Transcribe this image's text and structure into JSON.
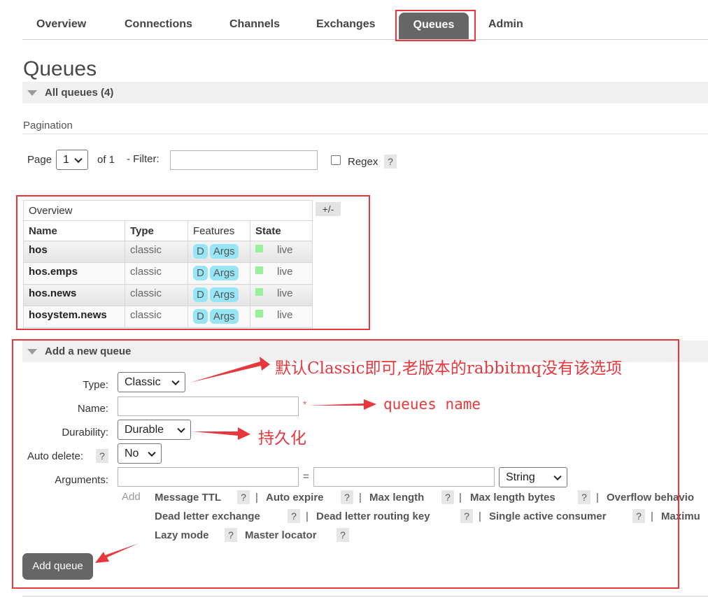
{
  "nav": {
    "tabs": [
      {
        "label": "Overview"
      },
      {
        "label": "Connections"
      },
      {
        "label": "Channels"
      },
      {
        "label": "Exchanges"
      },
      {
        "label": "Queues"
      },
      {
        "label": "Admin"
      }
    ],
    "active_tab": "Queues"
  },
  "page_title": "Queues",
  "all_queues": {
    "label": "All queues (4)"
  },
  "pagination": {
    "section_label": "Pagination",
    "page_label": "Page",
    "page_value": "1",
    "of_label": "of 1",
    "filter_label": "- Filter:",
    "filter_value": "",
    "regex_label": "Regex",
    "help": "?"
  },
  "table": {
    "caption": "Overview",
    "toggle_columns": "+/-",
    "headers": {
      "name": "Name",
      "type": "Type",
      "features": "Features",
      "state": "State"
    },
    "rows": [
      {
        "name": "hos",
        "type": "classic",
        "feat_d": "D",
        "feat_args": "Args",
        "state": "live"
      },
      {
        "name": "hos.emps",
        "type": "classic",
        "feat_d": "D",
        "feat_args": "Args",
        "state": "live"
      },
      {
        "name": "hos.news",
        "type": "classic",
        "feat_d": "D",
        "feat_args": "Args",
        "state": "live"
      },
      {
        "name": "hosystem.news",
        "type": "classic",
        "feat_d": "D",
        "feat_args": "Args",
        "state": "live"
      }
    ]
  },
  "add_queue": {
    "section_label": "Add a new queue",
    "type_label": "Type:",
    "type_value": "Classic",
    "name_label": "Name:",
    "name_value": "",
    "name_required": "*",
    "durability_label": "Durability:",
    "durability_value": "Durable",
    "auto_delete_label": "Auto delete:",
    "auto_delete_help": "?",
    "auto_delete_value": "No",
    "arguments_label": "Arguments:",
    "arg_key": "",
    "arg_equals": "=",
    "arg_value": "",
    "arg_type": "String",
    "add_label": "Add",
    "arg_links": {
      "message_ttl": "Message TTL",
      "auto_expire": "Auto expire",
      "max_length": "Max length",
      "max_length_bytes": "Max length bytes",
      "overflow_behaviour": "Overflow behavio",
      "dead_letter_exchange": "Dead letter exchange",
      "dead_letter_routing_key": "Dead letter routing key",
      "single_active_consumer": "Single active consumer",
      "maximum_priority": "Maximu",
      "lazy_mode": "Lazy mode",
      "master_locator": "Master locator"
    },
    "help": "?",
    "separator": "|",
    "submit_label": "Add queue"
  },
  "annotations": {
    "type_note": "默认Classic即可,老版本的rabbitmq没有该选项",
    "name_note": "queues name",
    "durability_note": "持久化",
    "color": "#e8383d"
  }
}
